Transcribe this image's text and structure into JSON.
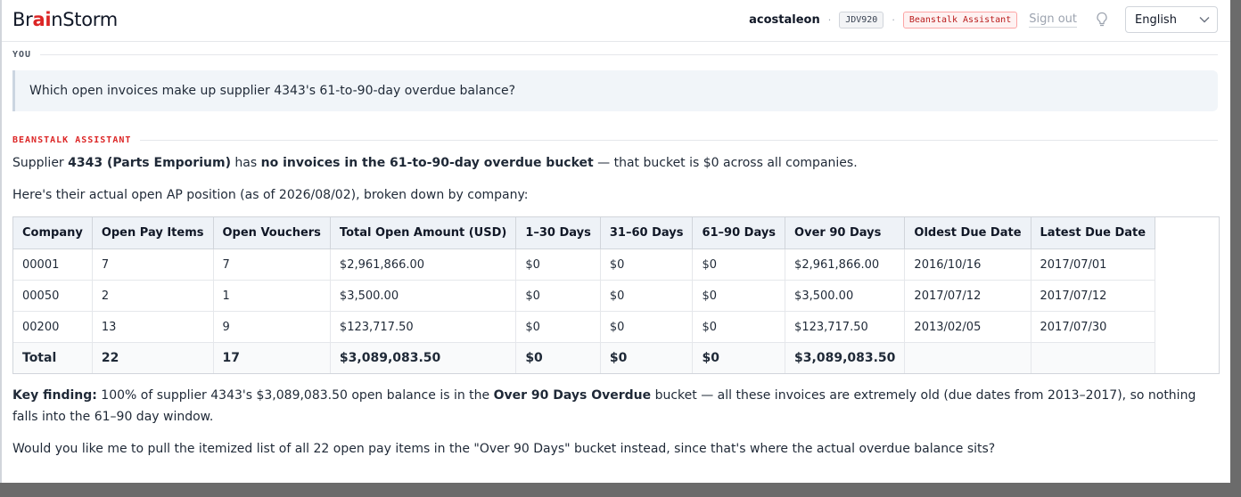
{
  "header": {
    "logo_pre": "Br",
    "logo_accent": "ai",
    "logo_post": "nStorm",
    "username": "acostaleon",
    "separator": "·",
    "env_code": "JDV920",
    "assistant_chip": "Beanstalk Assistant",
    "sign_out": "Sign out",
    "language": "English",
    "icons": [
      "lightbulb-icon",
      "chevron-down-icon"
    ]
  },
  "conversation": {
    "you_label": "YOU",
    "user_message": "Which open invoices make up supplier 4343's 61-to-90-day overdue balance?",
    "assistant_label": "BEANSTALK ASSISTANT",
    "intro": {
      "t1": "Supplier ",
      "b1": "4343 (Parts Emporium)",
      "t2": " has ",
      "b2": "no invoices in the 61-to-90-day overdue bucket",
      "t3": " — that bucket is $0 across all companies."
    },
    "position_line": "Here's their actual open AP position (as of 2026/08/02), broken down by company:",
    "table": {
      "columns": [
        "Company",
        "Open Pay Items",
        "Open Vouchers",
        "Total Open Amount (USD)",
        "1–30 Days",
        "31–60 Days",
        "61–90 Days",
        "Over 90 Days",
        "Oldest Due Date",
        "Latest Due Date"
      ],
      "rows": [
        [
          "00001",
          "7",
          "7",
          "$2,961,866.00",
          "$0",
          "$0",
          "$0",
          "$2,961,866.00",
          "2016/10/16",
          "2017/07/01"
        ],
        [
          "00050",
          "2",
          "1",
          "$3,500.00",
          "$0",
          "$0",
          "$0",
          "$3,500.00",
          "2017/07/12",
          "2017/07/12"
        ],
        [
          "00200",
          "13",
          "9",
          "$123,717.50",
          "$0",
          "$0",
          "$0",
          "$123,717.50",
          "2013/02/05",
          "2017/07/30"
        ]
      ],
      "total": [
        "Total",
        "22",
        "17",
        "$3,089,083.50",
        "$0",
        "$0",
        "$0",
        "$3,089,083.50",
        "",
        ""
      ]
    },
    "key_finding": {
      "label": "Key finding:",
      "t1": " 100% of supplier 4343's $3,089,083.50 open balance is in the ",
      "b1": "Over 90 Days Overdue",
      "t2": " bucket — all these invoices are extremely old (due dates from 2013–2017), so nothing falls into the 61–90 day window."
    },
    "follow_up": "Would you like me to pull the itemized list of all 22 open pay items in the \"Over 90 Days\" bucket instead, since that's where the actual overdue balance sits?"
  },
  "colors": {
    "accent_red": "#dc2626",
    "user_bubble": "#f1f5f9",
    "table_header": "#eef2f7"
  }
}
